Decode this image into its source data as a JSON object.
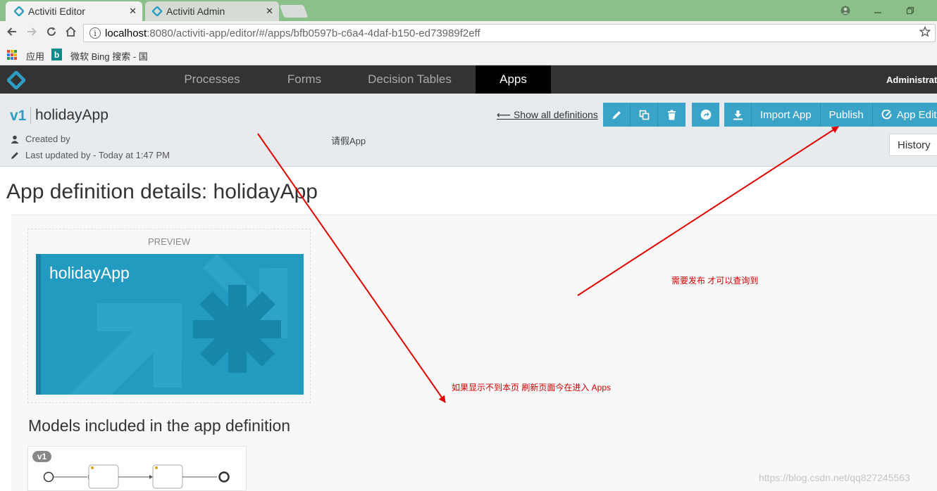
{
  "browser": {
    "tabs": [
      {
        "title": "Activiti Editor",
        "active": true
      },
      {
        "title": "Activiti Admin",
        "active": false
      }
    ],
    "url_host": "localhost",
    "url_rest": ":8080/activiti-app/editor/#/apps/bfb0597b-c6a4-4daf-b150-ed73989f2eff",
    "bookmarks": {
      "apps_label": "应用",
      "bing_label": "微软 Bing 搜索 - 国"
    },
    "tab_close_glyph": "✕"
  },
  "nav": {
    "items": [
      "Processes",
      "Forms",
      "Decision Tables",
      "Apps"
    ],
    "active": "Apps",
    "user": "Administrator"
  },
  "header": {
    "version": "v1",
    "app_name": "holidayApp",
    "created_by": "Created by",
    "last_updated": "Last updated by - Today at 1:47 PM",
    "description": "请假App",
    "show_all": "⟵ Show all definitions",
    "buttons": {
      "import_app": "Import App",
      "publish": "Publish",
      "app_editor": "App Editor"
    },
    "history": "History"
  },
  "main": {
    "title": "App definition details: holidayApp",
    "preview_label": "PREVIEW",
    "tile_name": "holidayApp",
    "models_title": "Models included in the app definition",
    "model_version": "v1"
  },
  "annotations": {
    "publish_note": "需要发布 才可以查询到",
    "refresh_note": "如果显示不到本页 刷新页面今在进入 Apps",
    "color": "#e00000"
  },
  "watermark": "https://blog.csdn.net/qq827245563",
  "colors": {
    "accent": "#3aa3c8",
    "navbar": "#333333",
    "tile": "#239bc0"
  }
}
